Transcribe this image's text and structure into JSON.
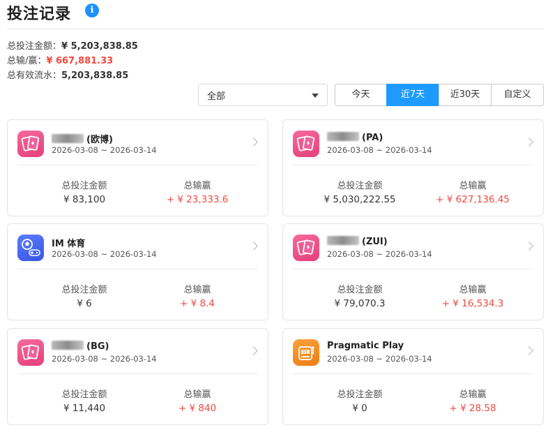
{
  "header": {
    "title": "投注记录",
    "info_icon": "info-icon"
  },
  "summary": {
    "total_bet_label": "总投注金额：",
    "total_bet_value": "¥ 5,203,838.85",
    "total_winloss_label": "总输/赢：",
    "total_winloss_value": "¥ 667,881.33",
    "total_turnover_label": "总有效流水：",
    "total_turnover_value": "5,203,838.85"
  },
  "filter": {
    "selected": "全部"
  },
  "tabs": [
    {
      "label": "今天",
      "active": false
    },
    {
      "label": "近7天",
      "active": true
    },
    {
      "label": "近30天",
      "active": false
    },
    {
      "label": "自定义",
      "active": false
    }
  ],
  "labels": {
    "bet": "总投注金额",
    "winloss": "总输赢"
  },
  "cards": [
    {
      "name": "(欧博)",
      "blurred_prefix": true,
      "icon": "playing-cards-icon",
      "date": "2026-03-08 ~ 2026-03-14",
      "bet": "¥ 83,100",
      "winloss": "+ ¥ 23,333.6"
    },
    {
      "name": "(PA)",
      "blurred_prefix": true,
      "icon": "playing-cards-icon",
      "date": "2026-03-08 ~ 2026-03-14",
      "bet": "¥ 5,030,222.55",
      "winloss": "+ ¥ 627,136.45"
    },
    {
      "name": "IM 体育",
      "blurred_prefix": false,
      "icon": "sports-ball-icon",
      "date": "2026-03-08 ~ 2026-03-14",
      "bet": "¥ 6",
      "winloss": "+ ¥ 8.4"
    },
    {
      "name": "(ZUI)",
      "blurred_prefix": true,
      "icon": "playing-cards-icon",
      "date": "2026-03-08 ~ 2026-03-14",
      "bet": "¥ 79,070.3",
      "winloss": "+ ¥ 16,534.3"
    },
    {
      "name": "(BG)",
      "blurred_prefix": true,
      "icon": "playing-cards-icon",
      "date": "2026-03-08 ~ 2026-03-14",
      "bet": "¥ 11,440",
      "winloss": "+ ¥ 840"
    },
    {
      "name": "Pragmatic Play",
      "blurred_prefix": false,
      "icon": "slot-machine-icon",
      "date": "2026-03-08 ~ 2026-03-14",
      "bet": "¥ 0",
      "winloss": "+ ¥ 28.58"
    }
  ],
  "colors": {
    "accent": "#1e9bff",
    "win": "#f0493e",
    "card_pink": "#e63f7a",
    "card_blue": "#3a55e8",
    "card_orange": "#ee7d12"
  }
}
